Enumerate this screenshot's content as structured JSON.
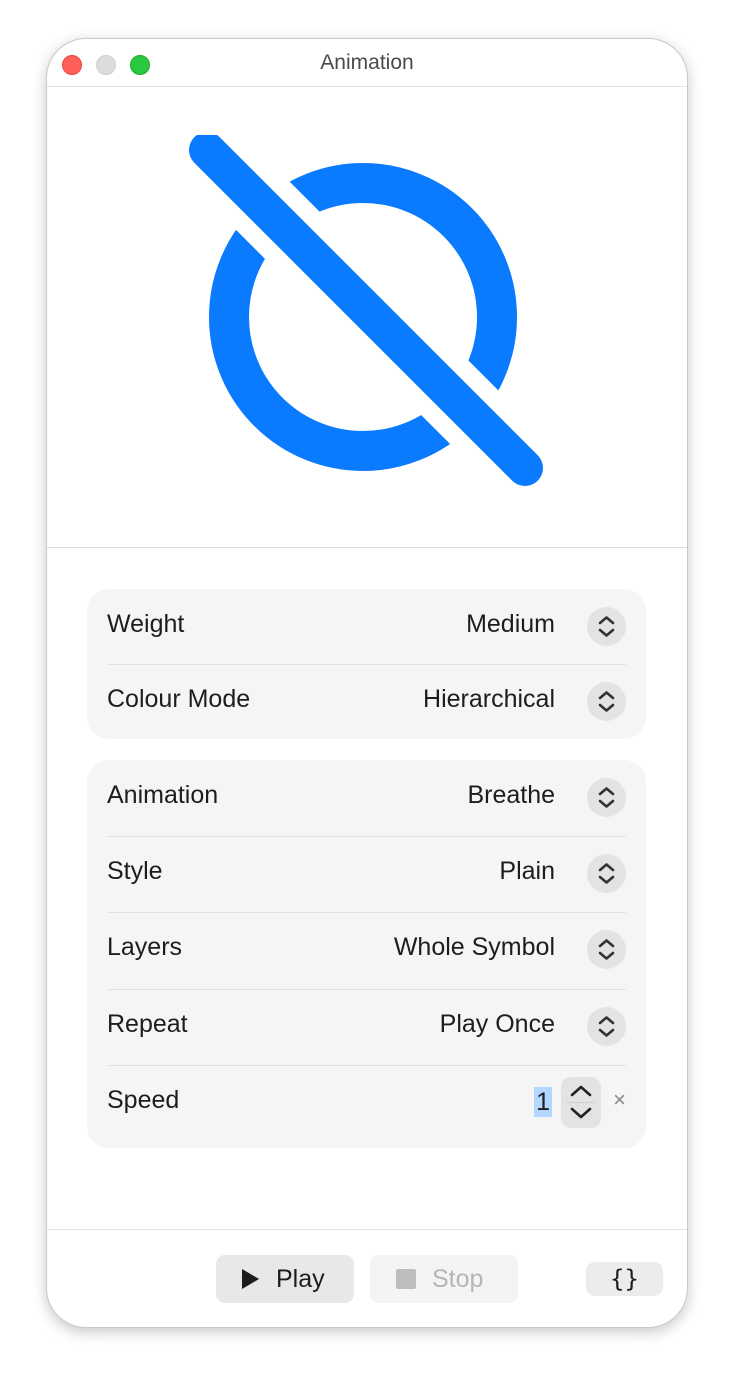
{
  "window": {
    "title": "Animation"
  },
  "preview": {
    "symbol_icon": "circle-slash-icon",
    "color": "#0a7aff"
  },
  "appearance": {
    "rows": [
      {
        "label": "Weight",
        "value": "Medium"
      },
      {
        "label": "Colour Mode",
        "value": "Hierarchical"
      }
    ]
  },
  "animation": {
    "rows": [
      {
        "label": "Animation",
        "value": "Breathe"
      },
      {
        "label": "Style",
        "value": "Plain"
      },
      {
        "label": "Layers",
        "value": "Whole Symbol"
      },
      {
        "label": "Repeat",
        "value": "Play Once"
      }
    ],
    "speed": {
      "label": "Speed",
      "value": "1",
      "clear_symbol": "×"
    }
  },
  "footer": {
    "play_label": "Play",
    "stop_label": "Stop",
    "code_label": "{}"
  }
}
